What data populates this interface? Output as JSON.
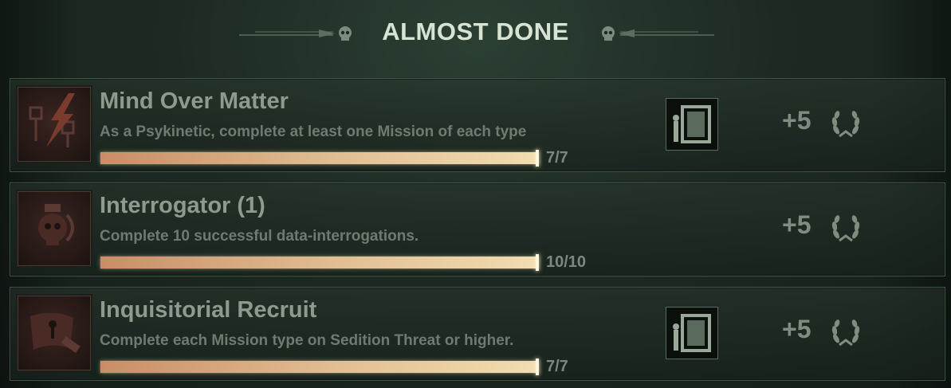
{
  "header": {
    "title": "ALMOST DONE"
  },
  "achievements": [
    {
      "title": "Mind Over Matter",
      "description": "As a Psykinetic, complete at least one Mission of each type",
      "progress_text": "7/7",
      "progress_fraction": 1.0,
      "has_reward_item": true,
      "points": "+5",
      "thumbnail_icon": "psyker-lightning-icon"
    },
    {
      "title": "Interrogator (1)",
      "description": "Complete 10 successful data-interrogations.",
      "progress_text": "10/10",
      "progress_fraction": 1.0,
      "has_reward_item": false,
      "points": "+5",
      "thumbnail_icon": "servo-skull-icon"
    },
    {
      "title": "Inquisitorial Recruit",
      "description": "Complete each Mission type on Sedition Threat or higher.",
      "progress_text": "7/7",
      "progress_fraction": 1.0,
      "has_reward_item": true,
      "points": "+5",
      "thumbnail_icon": "inquisition-seal-icon"
    }
  ],
  "colors": {
    "background": "#1d2a23",
    "title_text": "#d7e4d3",
    "progress_bar_start": "#c98e66",
    "progress_bar_end": "#f1ddb0"
  }
}
